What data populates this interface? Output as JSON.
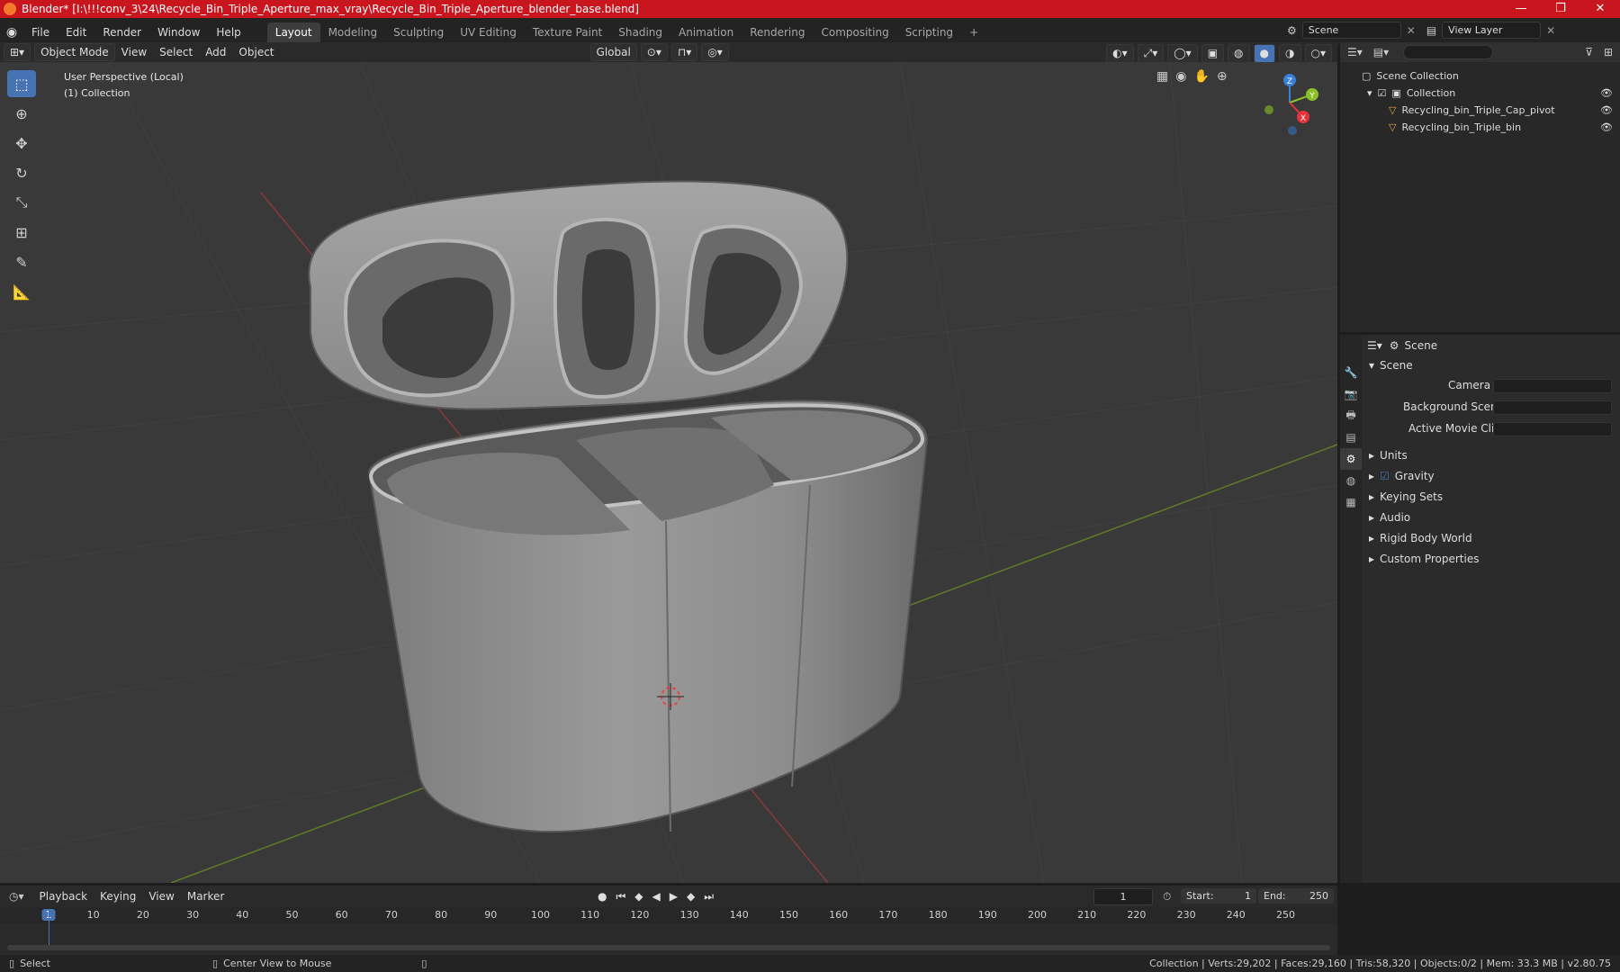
{
  "window": {
    "title": "Blender* [I:\\!!!conv_3\\24\\Recycle_Bin_Triple_Aperture_max_vray\\Recycle_Bin_Triple_Aperture_blender_base.blend]"
  },
  "menu": [
    "File",
    "Edit",
    "Render",
    "Window",
    "Help"
  ],
  "workspaces": [
    "Layout",
    "Modeling",
    "Sculpting",
    "UV Editing",
    "Texture Paint",
    "Shading",
    "Animation",
    "Rendering",
    "Compositing",
    "Scripting"
  ],
  "active_workspace": "Layout",
  "scene_selector": "Scene",
  "view_layer": "View Layer",
  "viewport_header": {
    "mode": "Object Mode",
    "menus": [
      "View",
      "Select",
      "Add",
      "Object"
    ],
    "transform_orientation": "Global"
  },
  "viewport": {
    "perspective": "User Perspective (Local)",
    "collection": "(1) Collection",
    "gizmo_axes": [
      "Z",
      "Y",
      "X"
    ]
  },
  "outliner": {
    "root": "Scene Collection",
    "collection": "Collection",
    "objects": [
      "Recycling_bin_Triple_Cap_pivot",
      "Recycling_bin_Triple_bin"
    ]
  },
  "properties": {
    "header": "Scene",
    "section": "Scene",
    "fields": [
      {
        "label": "Camera",
        "value": ""
      },
      {
        "label": "Background Scene",
        "value": ""
      },
      {
        "label": "Active Movie Clip",
        "value": ""
      }
    ],
    "panels": [
      "Units",
      "Gravity",
      "Keying Sets",
      "Audio",
      "Rigid Body World",
      "Custom Properties"
    ],
    "gravity_checked": true
  },
  "timeline": {
    "menus": [
      "Playback",
      "Keying",
      "View",
      "Marker"
    ],
    "current_frame": "1",
    "start_label": "Start:",
    "start": "1",
    "end_label": "End:",
    "end": "250",
    "ruler": [
      "1",
      "10",
      "20",
      "30",
      "40",
      "50",
      "60",
      "70",
      "80",
      "90",
      "100",
      "110",
      "120",
      "130",
      "140",
      "150",
      "160",
      "170",
      "180",
      "190",
      "200",
      "210",
      "220",
      "230",
      "240",
      "250"
    ]
  },
  "statusbar": {
    "left": "Select",
    "middle": "Center View to Mouse",
    "right": "Collection | Verts:29,202 | Faces:29,160 | Tris:58,320 | Objects:0/2 | Mem: 33.3 MB | v2.80.75"
  },
  "colors": {
    "titlebar": "#c9151e",
    "accent": "#4772b3",
    "x_axis": "#e6323c",
    "y_axis": "#8cbf2a",
    "z_axis": "#3a7fd8"
  }
}
